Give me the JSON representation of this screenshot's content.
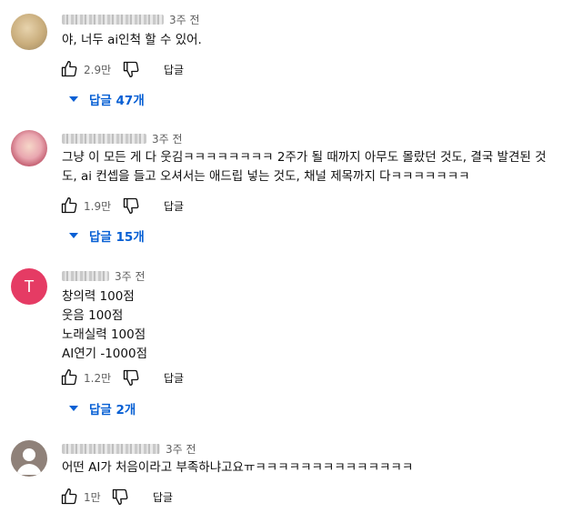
{
  "comments": [
    {
      "time": "3주 전",
      "lines": [
        "야, 너두 ai인척 할 수 있어."
      ],
      "likes": "2.9만",
      "reply_label": "답글",
      "replies_label": "답글 47개"
    },
    {
      "time": "3주 전",
      "lines": [
        "그냥 이 모든 게 다 웃김ㅋㅋㅋㅋㅋㅋㅋㅋ 2주가 될 때까지 아무도 몰랐던 것도, 결국 발견된 것",
        "도, ai 컨셉을 들고 오셔서는 애드립 넣는 것도, 채널 제목까지 다ㅋㅋㅋㅋㅋㅋㅋ"
      ],
      "likes": "1.9만",
      "reply_label": "답글",
      "replies_label": "답글 15개"
    },
    {
      "avatar_letter": "T",
      "time": "3주 전",
      "lines": [
        "창의력 100점",
        "웃음 100점",
        "노래실력 100점",
        "AI연기 -1000점"
      ],
      "likes": "1.2만",
      "reply_label": "답글",
      "replies_label": "답글 2개"
    },
    {
      "time": "3주 전",
      "lines": [
        "어떤 AI가 처음이라고 부족하냐고요ㅠㅋㅋㅋㅋㅋㅋㅋㅋㅋㅋㅋㅋㅋㅋ"
      ],
      "likes": "1만",
      "reply_label": "답글"
    }
  ],
  "colors": {
    "link": "#065fd4",
    "muted": "#606060",
    "text": "#0f0f0f"
  },
  "icons": {
    "like": "thumb-up-icon",
    "dislike": "thumb-down-icon",
    "expand": "caret-down-icon"
  }
}
